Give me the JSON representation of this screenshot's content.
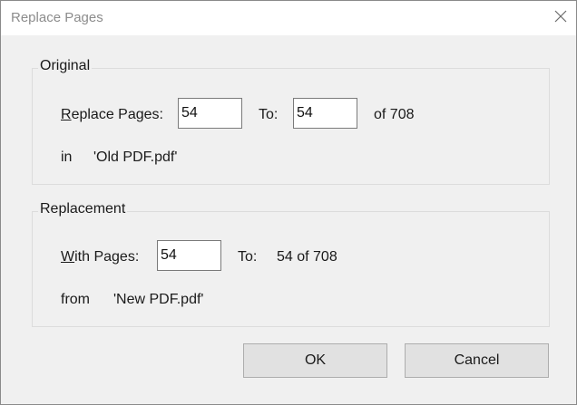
{
  "window": {
    "title": "Replace Pages",
    "close_icon": "close-icon"
  },
  "original": {
    "group_title": "Original",
    "replace_pages_label_accel": "R",
    "replace_pages_label_rest": "eplace Pages:",
    "replace_from_value": "54",
    "to_label": "To:",
    "replace_to_value": "54",
    "of_total": "of 708",
    "in_label": "in",
    "file_name": "'Old PDF.pdf'"
  },
  "replacement": {
    "group_title": "Replacement",
    "with_pages_label_accel": "W",
    "with_pages_label_rest": "ith Pages:",
    "with_from_value": "54",
    "to_label": "To:",
    "to_range_text": "54 of 708",
    "from_label": "from",
    "file_name": "'New PDF.pdf'"
  },
  "buttons": {
    "ok": "OK",
    "cancel": "Cancel"
  }
}
